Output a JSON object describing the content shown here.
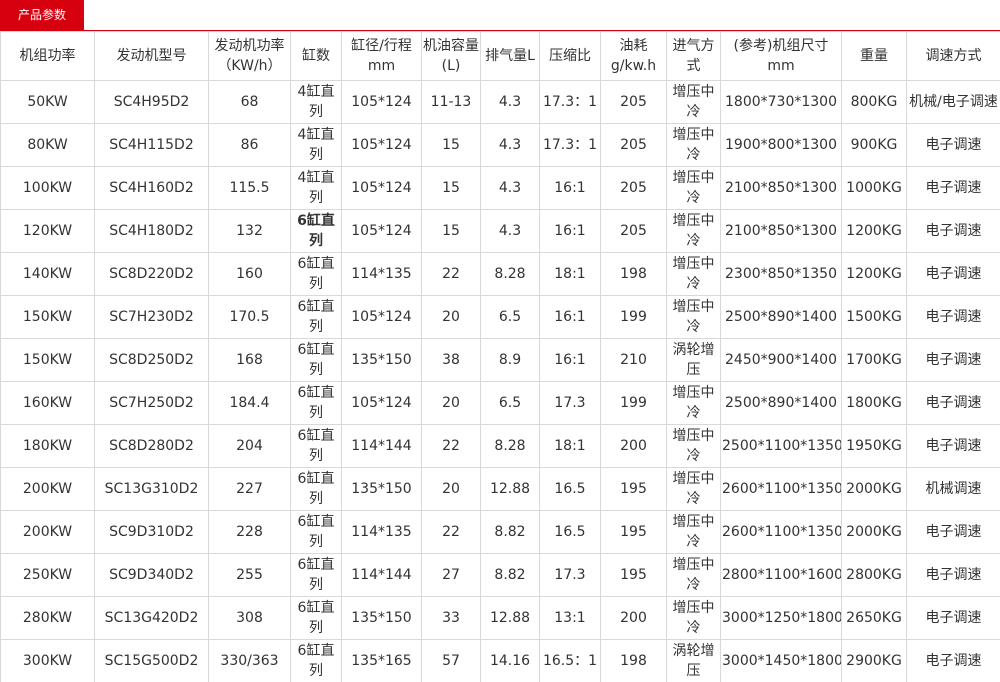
{
  "tab": {
    "label": "产品参数"
  },
  "headers": [
    "机组功率",
    "发动机型号",
    "发动机功率（KW/h）",
    "缸数",
    "缸径/行程mm",
    "机油容量(L)",
    "排气量L",
    "压缩比",
    "油耗g/kw.h",
    "进气方式",
    "(参考)机组尺寸mm",
    "重量",
    "调速方式"
  ],
  "rows": [
    [
      "50KW",
      "SC4H95D2",
      "68",
      "4缸直列",
      "105*124",
      "11-13",
      "4.3",
      "17.3：1",
      "205",
      "增压中冷",
      "1800*730*1300",
      "800KG",
      "机械/电子调速"
    ],
    [
      "80KW",
      "SC4H115D2",
      "86",
      "4缸直列",
      "105*124",
      "15",
      "4.3",
      "17.3：1",
      "205",
      "增压中冷",
      "1900*800*1300",
      "900KG",
      "电子调速"
    ],
    [
      "100KW",
      "SC4H160D2",
      "115.5",
      "4缸直列",
      "105*124",
      "15",
      "4.3",
      "16:1",
      "205",
      "增压中冷",
      "2100*850*1300",
      "1000KG",
      "电子调速"
    ],
    [
      "120KW",
      "SC4H180D2",
      "132",
      "6缸直列",
      "105*124",
      "15",
      "4.3",
      "16:1",
      "205",
      "增压中冷",
      "2100*850*1300",
      "1200KG",
      "电子调速"
    ],
    [
      "140KW",
      "SC8D220D2",
      "160",
      "6缸直列",
      "114*135",
      "22",
      "8.28",
      "18:1",
      "198",
      "增压中冷",
      "2300*850*1350",
      "1200KG",
      "电子调速"
    ],
    [
      "150KW",
      "SC7H230D2",
      "170.5",
      "6缸直列",
      "105*124",
      "20",
      "6.5",
      "16:1",
      "199",
      "增压中冷",
      "2500*890*1400",
      "1500KG",
      "电子调速"
    ],
    [
      "150KW",
      "SC8D250D2",
      "168",
      "6缸直列",
      "135*150",
      "38",
      "8.9",
      "16:1",
      "210",
      "涡轮增压",
      "2450*900*1400",
      "1700KG",
      "电子调速"
    ],
    [
      "160KW",
      "SC7H250D2",
      "184.4",
      "6缸直列",
      "105*124",
      "20",
      "6.5",
      "17.3",
      "199",
      "增压中冷",
      "2500*890*1400",
      "1800KG",
      "电子调速"
    ],
    [
      "180KW",
      "SC8D280D2",
      "204",
      "6缸直列",
      "114*144",
      "22",
      "8.28",
      "18:1",
      "200",
      "增压中冷",
      "2500*1100*1350",
      "1950KG",
      "电子调速"
    ],
    [
      "200KW",
      "SC13G310D2",
      "227",
      "6缸直列",
      "135*150",
      "20",
      "12.88",
      "16.5",
      "195",
      "增压中冷",
      "2600*1100*1350",
      "2000KG",
      "机械调速"
    ],
    [
      "200KW",
      "SC9D310D2",
      "228",
      "6缸直列",
      "114*135",
      "22",
      "8.82",
      "16.5",
      "195",
      "增压中冷",
      "2600*1100*1350",
      "2000KG",
      "电子调速"
    ],
    [
      "250KW",
      "SC9D340D2",
      "255",
      "6缸直列",
      "114*144",
      "27",
      "8.82",
      "17.3",
      "195",
      "增压中冷",
      "2800*1100*1600",
      "2800KG",
      "电子调速"
    ],
    [
      "280KW",
      "SC13G420D2",
      "308",
      "6缸直列",
      "135*150",
      "33",
      "12.88",
      "13:1",
      "200",
      "增压中冷",
      "3000*1250*1800",
      "2650KG",
      "电子调速"
    ],
    [
      "300KW",
      "SC15G500D2",
      "330/363",
      "6缸直列",
      "135*165",
      "57",
      "14.16",
      "16.5：1",
      "198",
      "涡轮增压",
      "3000*1450*1800",
      "2900KG",
      "电子调速"
    ]
  ],
  "colors": {
    "accent": "#d7000f",
    "border": "#d9d9d9",
    "text": "#333333"
  }
}
